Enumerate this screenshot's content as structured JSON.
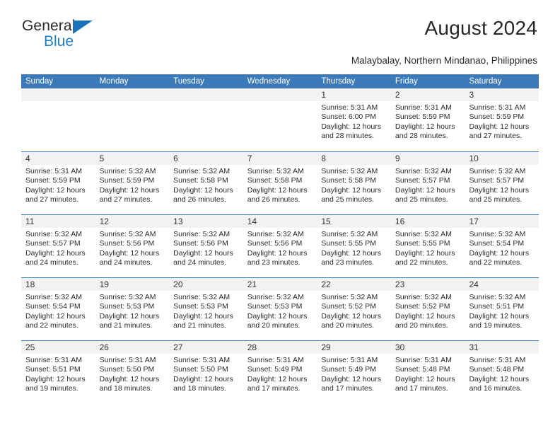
{
  "brand": {
    "name_part1": "General",
    "name_part2": "Blue",
    "triangle_color": "#1b72b8",
    "blue_color": "#1f7fc4"
  },
  "header": {
    "title": "August 2024",
    "subtitle": "Malaybalay, Northern Mindanao, Philippines"
  },
  "colors": {
    "header_blue": "#3b79b8",
    "day_strip": "#f2f2f2",
    "text": "#2c2c2c"
  },
  "calendar": {
    "weekdays": [
      "Sunday",
      "Monday",
      "Tuesday",
      "Wednesday",
      "Thursday",
      "Friday",
      "Saturday"
    ],
    "weeks": [
      [
        {
          "day": "",
          "sunrise": "",
          "sunset": "",
          "daylight1": "",
          "daylight2": ""
        },
        {
          "day": "",
          "sunrise": "",
          "sunset": "",
          "daylight1": "",
          "daylight2": ""
        },
        {
          "day": "",
          "sunrise": "",
          "sunset": "",
          "daylight1": "",
          "daylight2": ""
        },
        {
          "day": "",
          "sunrise": "",
          "sunset": "",
          "daylight1": "",
          "daylight2": ""
        },
        {
          "day": "1",
          "sunrise": "Sunrise: 5:31 AM",
          "sunset": "Sunset: 6:00 PM",
          "daylight1": "Daylight: 12 hours",
          "daylight2": "and 28 minutes."
        },
        {
          "day": "2",
          "sunrise": "Sunrise: 5:31 AM",
          "sunset": "Sunset: 5:59 PM",
          "daylight1": "Daylight: 12 hours",
          "daylight2": "and 28 minutes."
        },
        {
          "day": "3",
          "sunrise": "Sunrise: 5:31 AM",
          "sunset": "Sunset: 5:59 PM",
          "daylight1": "Daylight: 12 hours",
          "daylight2": "and 27 minutes."
        }
      ],
      [
        {
          "day": "4",
          "sunrise": "Sunrise: 5:31 AM",
          "sunset": "Sunset: 5:59 PM",
          "daylight1": "Daylight: 12 hours",
          "daylight2": "and 27 minutes."
        },
        {
          "day": "5",
          "sunrise": "Sunrise: 5:32 AM",
          "sunset": "Sunset: 5:59 PM",
          "daylight1": "Daylight: 12 hours",
          "daylight2": "and 27 minutes."
        },
        {
          "day": "6",
          "sunrise": "Sunrise: 5:32 AM",
          "sunset": "Sunset: 5:58 PM",
          "daylight1": "Daylight: 12 hours",
          "daylight2": "and 26 minutes."
        },
        {
          "day": "7",
          "sunrise": "Sunrise: 5:32 AM",
          "sunset": "Sunset: 5:58 PM",
          "daylight1": "Daylight: 12 hours",
          "daylight2": "and 26 minutes."
        },
        {
          "day": "8",
          "sunrise": "Sunrise: 5:32 AM",
          "sunset": "Sunset: 5:58 PM",
          "daylight1": "Daylight: 12 hours",
          "daylight2": "and 25 minutes."
        },
        {
          "day": "9",
          "sunrise": "Sunrise: 5:32 AM",
          "sunset": "Sunset: 5:57 PM",
          "daylight1": "Daylight: 12 hours",
          "daylight2": "and 25 minutes."
        },
        {
          "day": "10",
          "sunrise": "Sunrise: 5:32 AM",
          "sunset": "Sunset: 5:57 PM",
          "daylight1": "Daylight: 12 hours",
          "daylight2": "and 25 minutes."
        }
      ],
      [
        {
          "day": "11",
          "sunrise": "Sunrise: 5:32 AM",
          "sunset": "Sunset: 5:57 PM",
          "daylight1": "Daylight: 12 hours",
          "daylight2": "and 24 minutes."
        },
        {
          "day": "12",
          "sunrise": "Sunrise: 5:32 AM",
          "sunset": "Sunset: 5:56 PM",
          "daylight1": "Daylight: 12 hours",
          "daylight2": "and 24 minutes."
        },
        {
          "day": "13",
          "sunrise": "Sunrise: 5:32 AM",
          "sunset": "Sunset: 5:56 PM",
          "daylight1": "Daylight: 12 hours",
          "daylight2": "and 24 minutes."
        },
        {
          "day": "14",
          "sunrise": "Sunrise: 5:32 AM",
          "sunset": "Sunset: 5:56 PM",
          "daylight1": "Daylight: 12 hours",
          "daylight2": "and 23 minutes."
        },
        {
          "day": "15",
          "sunrise": "Sunrise: 5:32 AM",
          "sunset": "Sunset: 5:55 PM",
          "daylight1": "Daylight: 12 hours",
          "daylight2": "and 23 minutes."
        },
        {
          "day": "16",
          "sunrise": "Sunrise: 5:32 AM",
          "sunset": "Sunset: 5:55 PM",
          "daylight1": "Daylight: 12 hours",
          "daylight2": "and 22 minutes."
        },
        {
          "day": "17",
          "sunrise": "Sunrise: 5:32 AM",
          "sunset": "Sunset: 5:54 PM",
          "daylight1": "Daylight: 12 hours",
          "daylight2": "and 22 minutes."
        }
      ],
      [
        {
          "day": "18",
          "sunrise": "Sunrise: 5:32 AM",
          "sunset": "Sunset: 5:54 PM",
          "daylight1": "Daylight: 12 hours",
          "daylight2": "and 22 minutes."
        },
        {
          "day": "19",
          "sunrise": "Sunrise: 5:32 AM",
          "sunset": "Sunset: 5:53 PM",
          "daylight1": "Daylight: 12 hours",
          "daylight2": "and 21 minutes."
        },
        {
          "day": "20",
          "sunrise": "Sunrise: 5:32 AM",
          "sunset": "Sunset: 5:53 PM",
          "daylight1": "Daylight: 12 hours",
          "daylight2": "and 21 minutes."
        },
        {
          "day": "21",
          "sunrise": "Sunrise: 5:32 AM",
          "sunset": "Sunset: 5:53 PM",
          "daylight1": "Daylight: 12 hours",
          "daylight2": "and 20 minutes."
        },
        {
          "day": "22",
          "sunrise": "Sunrise: 5:32 AM",
          "sunset": "Sunset: 5:52 PM",
          "daylight1": "Daylight: 12 hours",
          "daylight2": "and 20 minutes."
        },
        {
          "day": "23",
          "sunrise": "Sunrise: 5:32 AM",
          "sunset": "Sunset: 5:52 PM",
          "daylight1": "Daylight: 12 hours",
          "daylight2": "and 20 minutes."
        },
        {
          "day": "24",
          "sunrise": "Sunrise: 5:32 AM",
          "sunset": "Sunset: 5:51 PM",
          "daylight1": "Daylight: 12 hours",
          "daylight2": "and 19 minutes."
        }
      ],
      [
        {
          "day": "25",
          "sunrise": "Sunrise: 5:31 AM",
          "sunset": "Sunset: 5:51 PM",
          "daylight1": "Daylight: 12 hours",
          "daylight2": "and 19 minutes."
        },
        {
          "day": "26",
          "sunrise": "Sunrise: 5:31 AM",
          "sunset": "Sunset: 5:50 PM",
          "daylight1": "Daylight: 12 hours",
          "daylight2": "and 18 minutes."
        },
        {
          "day": "27",
          "sunrise": "Sunrise: 5:31 AM",
          "sunset": "Sunset: 5:50 PM",
          "daylight1": "Daylight: 12 hours",
          "daylight2": "and 18 minutes."
        },
        {
          "day": "28",
          "sunrise": "Sunrise: 5:31 AM",
          "sunset": "Sunset: 5:49 PM",
          "daylight1": "Daylight: 12 hours",
          "daylight2": "and 17 minutes."
        },
        {
          "day": "29",
          "sunrise": "Sunrise: 5:31 AM",
          "sunset": "Sunset: 5:49 PM",
          "daylight1": "Daylight: 12 hours",
          "daylight2": "and 17 minutes."
        },
        {
          "day": "30",
          "sunrise": "Sunrise: 5:31 AM",
          "sunset": "Sunset: 5:48 PM",
          "daylight1": "Daylight: 12 hours",
          "daylight2": "and 17 minutes."
        },
        {
          "day": "31",
          "sunrise": "Sunrise: 5:31 AM",
          "sunset": "Sunset: 5:48 PM",
          "daylight1": "Daylight: 12 hours",
          "daylight2": "and 16 minutes."
        }
      ]
    ]
  }
}
